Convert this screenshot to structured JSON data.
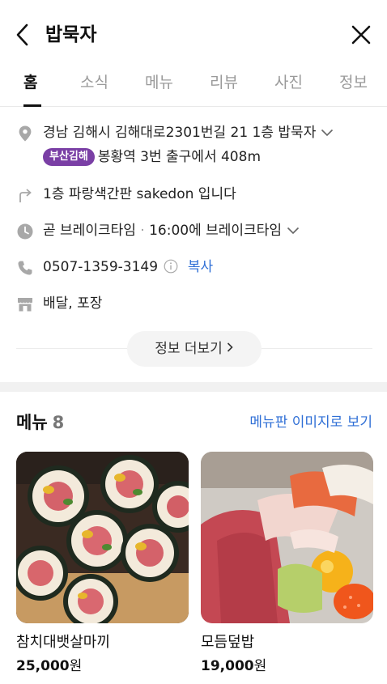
{
  "header": {
    "title": "밥묵자",
    "back_icon": "chevron-left-icon",
    "close_icon": "close-icon"
  },
  "tabs": [
    {
      "label": "홈",
      "active": true
    },
    {
      "label": "소식",
      "active": false
    },
    {
      "label": "메뉴",
      "active": false
    },
    {
      "label": "리뷰",
      "active": false
    },
    {
      "label": "사진",
      "active": false
    },
    {
      "label": "정보",
      "active": false
    }
  ],
  "info": {
    "address": "경남 김해시 김해대로2301번길 21 1층 밥묵자",
    "badge": "부산김해",
    "subway": "봉황역 3번 출구에서 408m",
    "directions": "1층 파랑색간판 sakedon 입니다",
    "hours_status": "곧 브레이크타임",
    "hours_sep": "·",
    "hours_detail": "16:00에 브레이크타임",
    "phone": "0507-1359-3149",
    "copy_label": "복사",
    "services": "배달, 포장",
    "more_label": "정보 더보기",
    "badge_color": "#7a3fa5"
  },
  "menu_section": {
    "title": "메뉴",
    "count": "8",
    "image_link": "메뉴판 이미지로 보기",
    "items": [
      {
        "name": "참치대뱃살마끼",
        "price": "25,000",
        "unit": "원"
      },
      {
        "name": "모듬덮밥",
        "price": "19,000",
        "unit": "원"
      }
    ]
  },
  "colors": {
    "link": "#2f6fd6",
    "icon": "#a8a8a8"
  }
}
